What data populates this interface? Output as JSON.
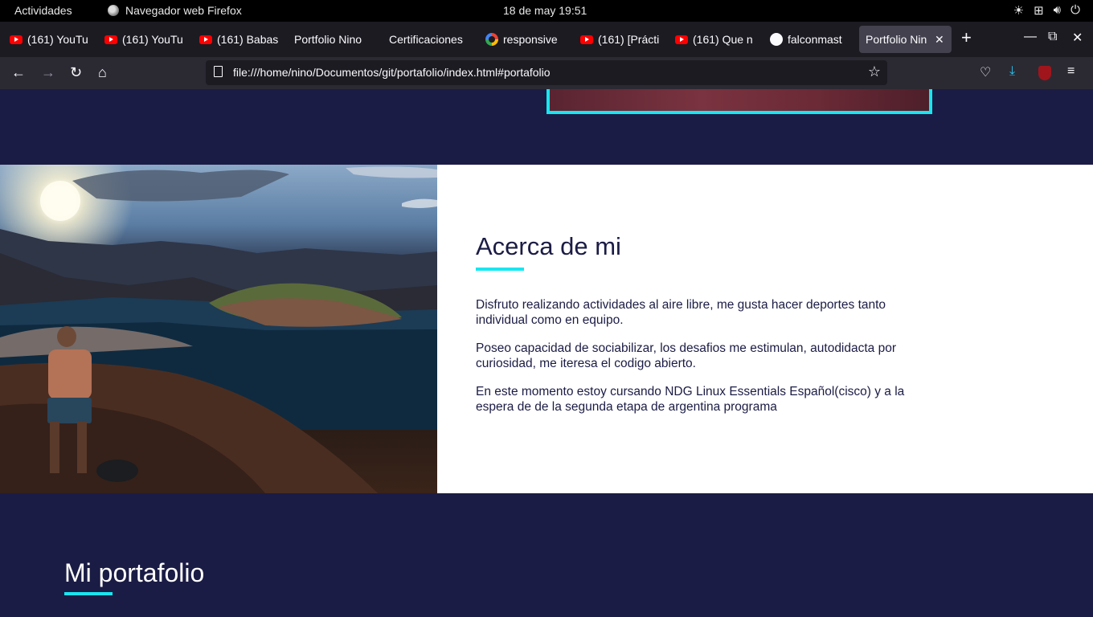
{
  "system_bar": {
    "activities": "Actividades",
    "app_name": "Navegador web Firefox",
    "clock": "18 de may  19:51",
    "tray_icons": [
      "brightness-icon",
      "network-icon",
      "volume-icon",
      "power-icon"
    ]
  },
  "tabs": [
    {
      "label": "(161) YouTu",
      "icon": "youtube-icon"
    },
    {
      "label": "(161) YouTu",
      "icon": "youtube-icon"
    },
    {
      "label": "(161) Babas",
      "icon": "youtube-icon"
    },
    {
      "label": "Portfolio Nino",
      "icon": ""
    },
    {
      "label": "Certificaciones",
      "icon": ""
    },
    {
      "label": "responsive",
      "icon": "google-icon"
    },
    {
      "label": "(161) [Prácti",
      "icon": "youtube-icon"
    },
    {
      "label": "(161) Que n",
      "icon": "youtube-icon"
    },
    {
      "label": "falconmast",
      "icon": "github-icon"
    },
    {
      "label": "Portfolio Nin",
      "icon": "",
      "active": true
    }
  ],
  "navbar": {
    "url": "file:///home/nino/Documentos/git/portafolio/index.html#portafolio"
  },
  "page": {
    "about": {
      "title": "Acerca de mi",
      "paragraphs": [
        "Disfruto realizando actividades al aire libre, me gusta hacer deportes tanto individual como en equipo.",
        "Poseo capacidad de sociabilizar, los desafios me estimulan, autodidacta por curiosidad, me iteresa el codigo abierto.",
        "En este momento estoy cursando NDG Linux Essentials Español(cisco) y a la espera de de la segunda etapa de argentina programa"
      ]
    },
    "portfolio": {
      "title": "Mi portafolio"
    }
  },
  "colors": {
    "page_bg": "#1b1c45",
    "accent": "#18e6f0"
  }
}
